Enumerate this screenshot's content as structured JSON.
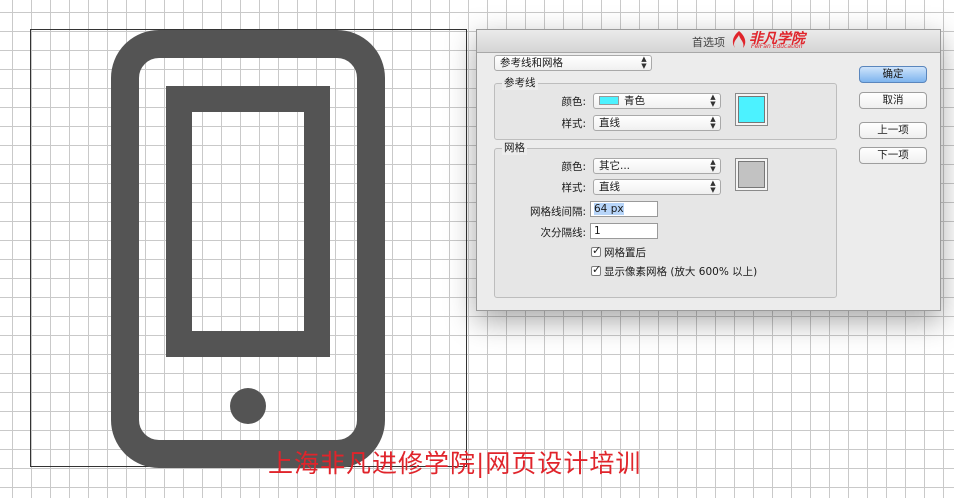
{
  "dialog": {
    "title": "首选项",
    "logo_text": "非凡学院",
    "logo_sub": "FeiFan Education",
    "category_select": "参考线和网格",
    "guides": {
      "group_label": "参考线",
      "color_label": "颜色:",
      "color_value": "青色",
      "color_swatch": "#4cf2ff",
      "style_label": "样式:",
      "style_value": "直线"
    },
    "grid": {
      "group_label": "网格",
      "color_label": "颜色:",
      "color_value": "其它...",
      "color_swatch": "#c2c2c2",
      "style_label": "样式:",
      "style_value": "直线",
      "gridline_label": "网格线间隔:",
      "gridline_value": "64 px",
      "subdivisions_label": "次分隔线:",
      "subdivisions_value": "1",
      "grids_in_back_label": "网格置后",
      "grids_in_back_checked": true,
      "pixel_grid_label": "显示像素网格 (放大 600% 以上)",
      "pixel_grid_checked": true
    },
    "buttons": {
      "ok": "确定",
      "cancel": "取消",
      "previous": "上一项",
      "next": "下一项"
    }
  },
  "artwork": {
    "icon_color": "#545454",
    "canvas_background": "#ffffff"
  },
  "watermark": "上海非凡进修学院|网页设计培训"
}
